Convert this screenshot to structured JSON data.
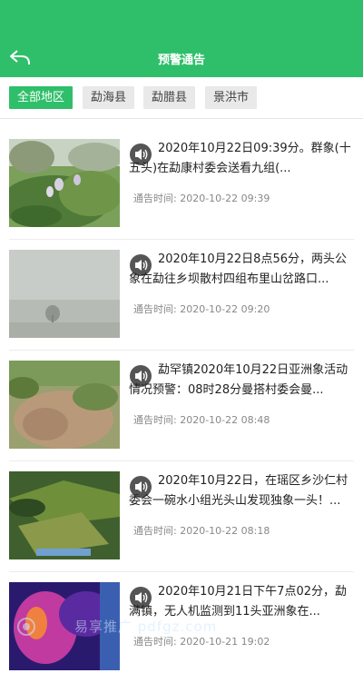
{
  "header": {
    "title": "预警通告",
    "back_icon": "back-arrow-icon"
  },
  "filters": [
    {
      "label": "全部地区",
      "active": true
    },
    {
      "label": "勐海县",
      "active": false
    },
    {
      "label": "勐腊县",
      "active": false
    },
    {
      "label": "景洪市",
      "active": false
    }
  ],
  "notices": [
    {
      "headline": "2020年10月22日09:39分。群象(十五头)在勐康村委会送看九组(...",
      "time": "通告时间:  2020-10-22 09:39",
      "icon": "speaker-icon"
    },
    {
      "headline": "2020年10月22日8点56分，两头公象在勐往乡坝散村四组布里山岔路口...",
      "time": "通告时间:  2020-10-22 09:20",
      "icon": "speaker-icon"
    },
    {
      "headline": "勐罕镇2020年10月22日亚洲象活动情况预警：08时28分曼搭村委会曼...",
      "time": "通告时间:  2020-10-22 08:48",
      "icon": "speaker-icon"
    },
    {
      "headline": "2020年10月22日，在瑶区乡沙仁村委会一碗水小组光头山发现独象一头！...",
      "time": "通告时间:  2020-10-22 08:18",
      "icon": "speaker-icon"
    },
    {
      "headline": "2020年10月21日下午7点02分，勐满镇，无人机监测到11头亚洲象在...",
      "time": "通告时间:  2020-10-21 19:02",
      "icon": "speaker-icon"
    }
  ],
  "watermark": {
    "text": "易享推广 pdfgz.com"
  },
  "colors": {
    "brand": "#2fbf6a"
  }
}
